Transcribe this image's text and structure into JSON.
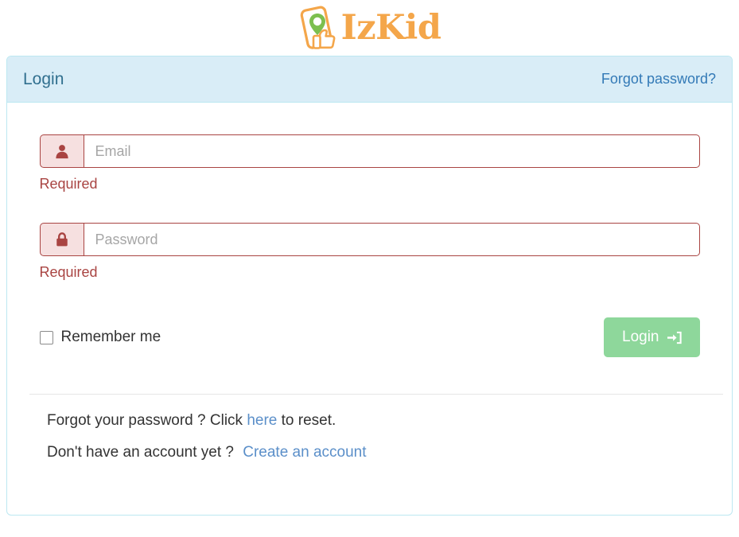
{
  "brand": {
    "name": "IzKid",
    "logo_icon": "phone-location-thumbsup-logo",
    "logo_color": "#f4a64a",
    "pin_color": "#7cbf4f"
  },
  "panel": {
    "header": {
      "title": "Login",
      "forgot_link": "Forgot password?"
    },
    "form": {
      "email": {
        "placeholder": "Email",
        "value": "",
        "icon": "user-icon",
        "error": "Required"
      },
      "password": {
        "placeholder": "Password",
        "value": "",
        "icon": "lock-icon",
        "error": "Required"
      },
      "remember": {
        "label": "Remember me",
        "checked": false
      },
      "submit": {
        "label": "Login",
        "icon": "sign-in-icon"
      }
    },
    "footer": {
      "line1": {
        "before": "Forgot your password ? Click",
        "link": "here",
        "after": "to reset."
      },
      "line2": {
        "before": "Don't have an account yet ?",
        "link": "Create an account"
      }
    }
  },
  "colors": {
    "header_bg": "#d9edf7",
    "header_border": "#bce8f1",
    "header_title": "#31708f",
    "link": "#337ab7",
    "error": "#a94442",
    "error_bg": "#f6e0e0",
    "button": "#8ed79b",
    "footer_link": "#5b8fc9"
  }
}
